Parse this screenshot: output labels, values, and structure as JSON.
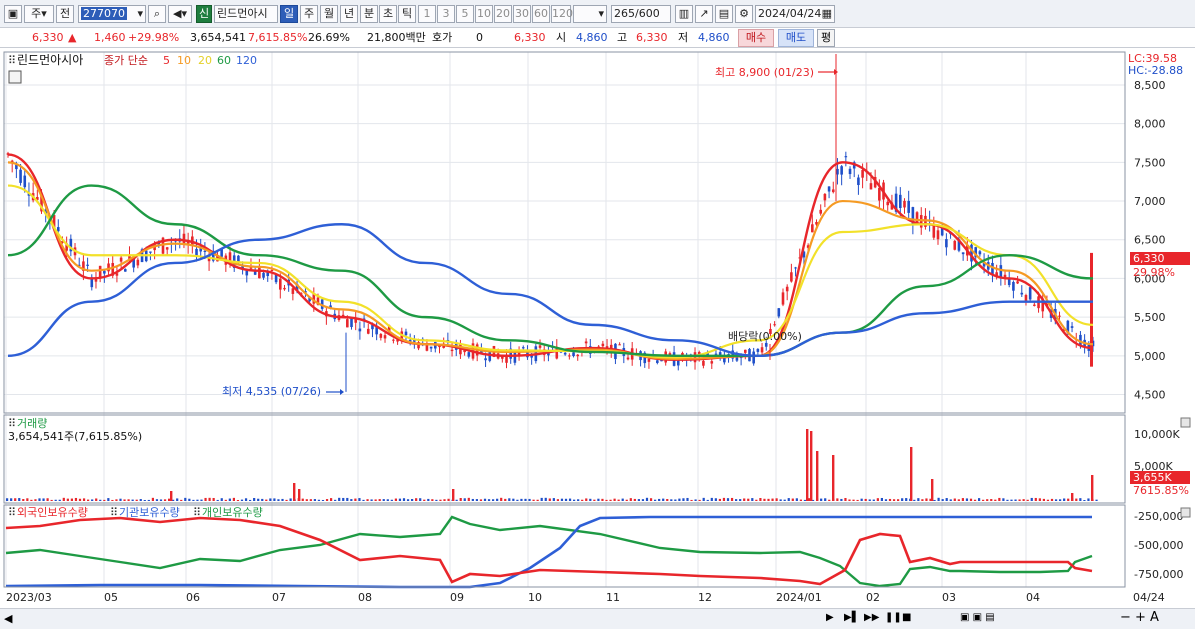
{
  "toolbar": {
    "period_main": "주",
    "prev": "전",
    "code": "277070",
    "badge": "신",
    "stock_name": "린드먼아시",
    "periods": [
      "일",
      "주",
      "월",
      "년",
      "분",
      "초",
      "틱"
    ],
    "numbers": [
      "1",
      "3",
      "5",
      "10",
      "20",
      "30",
      "60",
      "120"
    ],
    "count": "265",
    "count_total": "/600",
    "date": "2024/04/24"
  },
  "info": {
    "price": "6,330",
    "change": "1,460",
    "change_pct": "+29.98%",
    "volume": "3,654,541",
    "volume_pct": "7,615.85%",
    "turnover": "26.69%",
    "amount": "21,800백만",
    "hoga_label": "호가",
    "hoga_value": "0",
    "hoga_price": "6,330",
    "open_label": "시",
    "open": "4,860",
    "high_label": "고",
    "high": "6,330",
    "low_label": "저",
    "low": "4,860",
    "buy": "매수",
    "sell": "매도",
    "avg": "평"
  },
  "price_panel": {
    "name": "린드먼아시아",
    "legend_title": "종가 단순",
    "ma_labels": [
      "5",
      "10",
      "20",
      "60",
      "120"
    ],
    "ma_colors": [
      "#e8262b",
      "#f59a23",
      "#f2e12a",
      "#1e9a44",
      "#2e5fd6"
    ],
    "lc": "LC:39.58",
    "hc": "HC:-28.88",
    "high_marker": "최고 8,900 (01/23)",
    "low_marker": "최저 4,535 (07/26)",
    "dividend_marker": "배당락(0.00%)",
    "price_tag": "6,330",
    "pct_tag": "29.98%",
    "y_ticks": [
      "8,500",
      "8,000",
      "7,500",
      "7,000",
      "6,500",
      "6,000",
      "5,500",
      "5,000",
      "4,500"
    ]
  },
  "volume_panel": {
    "title": "거래량",
    "value": "3,654,541주(7,615.85%)",
    "y_ticks": [
      "10,000K",
      "5,000K"
    ],
    "tag_value": "3,655K",
    "tag_pct": "7615.85%"
  },
  "holdings_panel": {
    "legends": [
      "외국인보유수량",
      "기관보유수량",
      "개인보유수량"
    ],
    "legend_colors": [
      "#e8262b",
      "#2e5fd6",
      "#1e9a44"
    ],
    "y_ticks": [
      "-250,000",
      "-500,000",
      "-750,000"
    ]
  },
  "x_axis": [
    "2023/03",
    "05",
    "06",
    "07",
    "08",
    "09",
    "10",
    "11",
    "12",
    "2024/01",
    "02",
    "03",
    "04",
    "04/24"
  ],
  "chart_data": {
    "type": "line",
    "title": "린드먼아시아",
    "x": [
      "2023/03",
      "05",
      "06",
      "07",
      "08",
      "09",
      "10",
      "11",
      "12",
      "2024/01",
      "02",
      "03",
      "04",
      "04/24"
    ],
    "series": [
      {
        "name": "5",
        "values": [
          7600,
          6000,
          6500,
          6100,
          5500,
          5150,
          5000,
          5100,
          4950,
          5000,
          7500,
          6700,
          6000,
          5100
        ]
      },
      {
        "name": "10",
        "values": [
          7500,
          6100,
          6450,
          6150,
          5600,
          5150,
          5050,
          5080,
          4960,
          5000,
          7000,
          6750,
          6100,
          5150
        ]
      },
      {
        "name": "20",
        "values": [
          7200,
          6300,
          6300,
          6200,
          5700,
          5200,
          5070,
          5060,
          4980,
          5200,
          6600,
          6700,
          6300,
          5400
        ]
      },
      {
        "name": "60",
        "values": [
          6300,
          7200,
          6700,
          6300,
          6100,
          5500,
          5200,
          5050,
          5000,
          5000,
          5300,
          5900,
          6300,
          6000
        ]
      },
      {
        "name": "120",
        "values": [
          5000,
          5700,
          6200,
          6500,
          6700,
          6200,
          5800,
          5400,
          5200,
          5000,
          5300,
          5550,
          5700,
          5700
        ]
      }
    ],
    "ylim": [
      4300,
      8900
    ],
    "high": {
      "value": 8900,
      "date": "01/23"
    },
    "low": {
      "value": 4535,
      "date": "07/26"
    }
  }
}
